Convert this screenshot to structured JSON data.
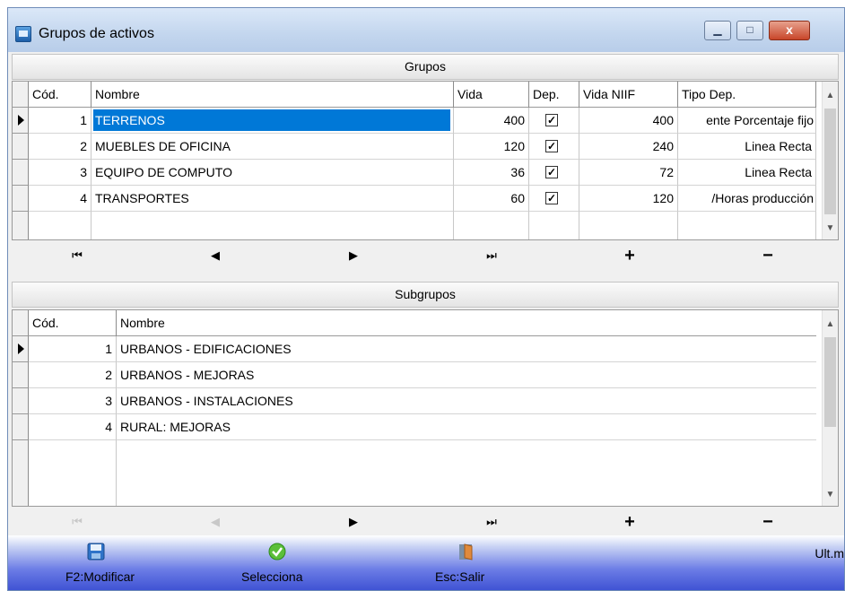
{
  "window": {
    "title": "Grupos de activos",
    "close_label": "x"
  },
  "grupos": {
    "header": "Grupos",
    "columns": [
      "Cód.",
      "Nombre",
      "Vida",
      "Dep.",
      "Vida NIIF",
      "Tipo Dep."
    ],
    "rows": [
      {
        "cod": "1",
        "nombre": "TERRENOS",
        "vida": "400",
        "dep": true,
        "vida_niif": "400",
        "tipo": "ente Porcentaje fijo"
      },
      {
        "cod": "2",
        "nombre": "MUEBLES DE OFICINA",
        "vida": "120",
        "dep": true,
        "vida_niif": "240",
        "tipo": "Linea Recta"
      },
      {
        "cod": "3",
        "nombre": "EQUIPO DE COMPUTO",
        "vida": "36",
        "dep": true,
        "vida_niif": "72",
        "tipo": "Linea Recta"
      },
      {
        "cod": "4",
        "nombre": "TRANSPORTES",
        "vida": "60",
        "dep": true,
        "vida_niif": "120",
        "tipo": "/Horas producción"
      }
    ]
  },
  "subgrupos": {
    "header": "Subgrupos",
    "columns": [
      "Cód.",
      "Nombre"
    ],
    "rows": [
      {
        "cod": "1",
        "nombre": "URBANOS - EDIFICACIONES"
      },
      {
        "cod": "2",
        "nombre": "URBANOS - MEJORAS"
      },
      {
        "cod": "3",
        "nombre": "URBANOS - INSTALACIONES"
      },
      {
        "cod": "4",
        "nombre": "RURAL: MEJORAS"
      }
    ]
  },
  "nav": {
    "first": "⏮",
    "prev": "◀",
    "next": "▶",
    "last": "⏭",
    "add": "+",
    "remove": "−"
  },
  "statusbar": {
    "modificar": "F2:Modificar",
    "selecciona": "Selecciona",
    "salir": "Esc:Salir",
    "ult": "Ult.m"
  },
  "colors": {
    "selection": "#0078d7",
    "statusbar_dark": "#3b4fd2"
  }
}
